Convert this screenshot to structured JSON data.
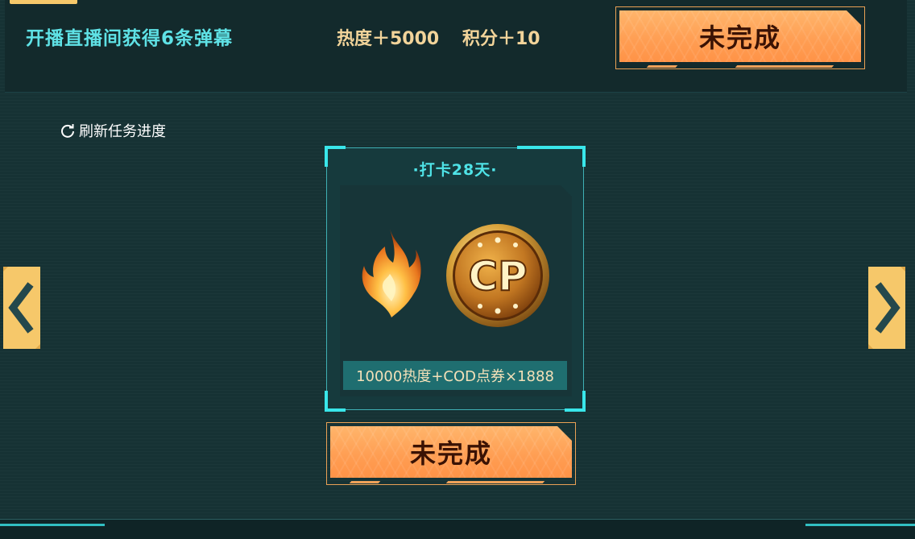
{
  "task": {
    "name": "开播直播间获得6条弹幕",
    "reward_heat": "热度＋5000",
    "reward_points": "积分＋10",
    "status_button": "未完成"
  },
  "refresh": {
    "label": "刷新任务进度"
  },
  "card": {
    "title": "·打卡28天·",
    "reward_text": "10000热度+COD点券×1888",
    "coin_text": "CP",
    "status_button": "未完成"
  },
  "nav": {
    "prev_icon": "chevron-left-icon",
    "next_icon": "chevron-right-icon"
  },
  "colors": {
    "background": "#163234",
    "accent_cyan": "#39e6ea",
    "button_orange": "#ff9d52",
    "arrow_yellow": "#f6c86a",
    "task_name": "#5fe2e6",
    "reward_text": "#f2d49a"
  }
}
